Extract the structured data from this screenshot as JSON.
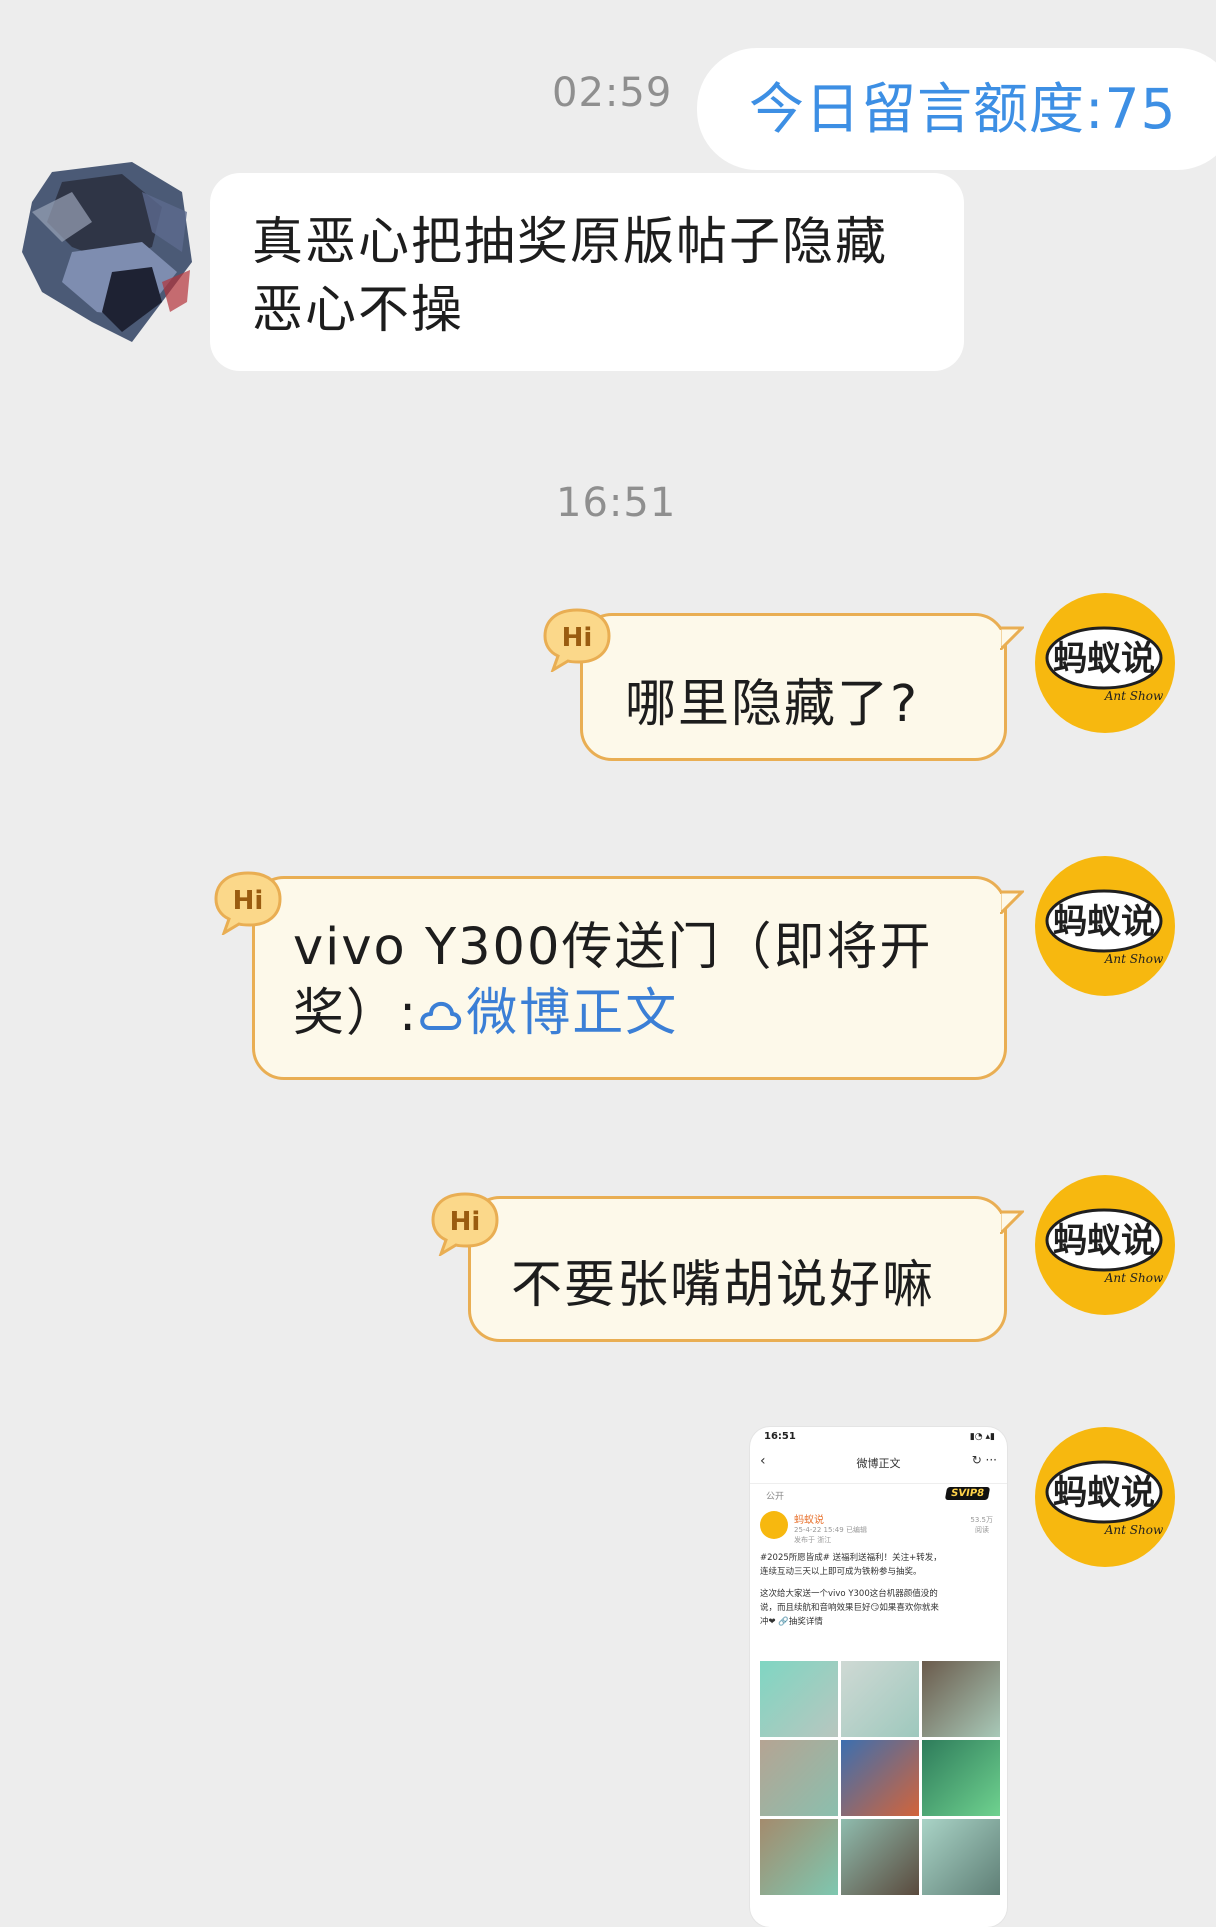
{
  "chat": {
    "time1": "02:59",
    "quota_label": "今日留言额度:75",
    "incoming_line1": "真恶心把抽奖原版帖子隐藏",
    "incoming_line2": "恶心不操",
    "time2": "16:51",
    "reply1": "哪里隐藏了?",
    "reply2_line1": "vivo Y300传送门（即将开",
    "reply2_line2_prefix": "奖）:",
    "reply2_link": "微博正文",
    "reply3": "不要张嘴胡说好嘛",
    "hi_label": "Hi",
    "avatar_text": "蚂蚁说",
    "avatar_sub": "Ant Show"
  },
  "screenshot": {
    "status_time": "16:51",
    "nav_title": "微博正文",
    "visibility": "公开",
    "badge": "SVIP8",
    "author": "蚂蚁说",
    "meta_line1": "25-4-22 15:49 已编辑",
    "meta_line2": "发布于 浙江",
    "stats": "53.5万",
    "stats_sub": "阅读",
    "body_line1": "#2025所愿皆成# 送福利送福利！关注+转发，",
    "body_line2": "连续互动三天以上即可成为铁粉参与抽奖。",
    "body_line3": "这次给大家送一个vivo Y300这台机器颜值没的",
    "body_line4": "说，而且续航和音响效果巨好😏如果喜欢你就来",
    "body_line5": "冲❤ 🔗抽奖详情"
  },
  "colors": {
    "background": "#ededed",
    "accent_blue": "#3d8fe4",
    "bubble_border": "#e9ae53",
    "bubble_fill": "#fdf9ea",
    "avatar_yellow": "#f7b80f"
  },
  "icons": {
    "user_avatar": "blurred-profile-avatar",
    "ant_avatar": "ant-show-logo",
    "hi_badge": "hi-speech-badge",
    "link_icon": "weibo-cloud-icon"
  }
}
